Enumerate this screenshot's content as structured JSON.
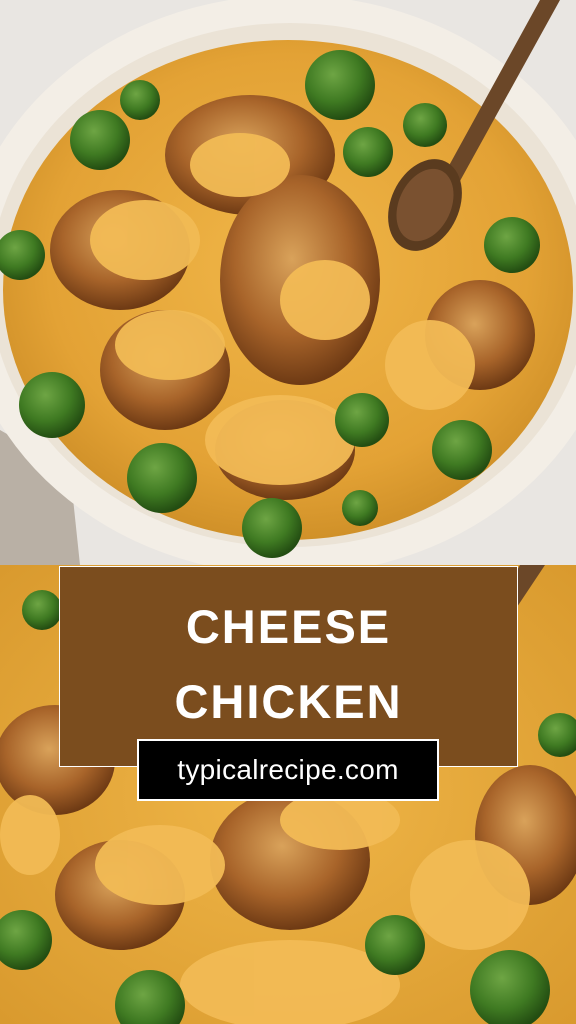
{
  "title": {
    "line1": "CHEESE",
    "line2": "CHICKEN"
  },
  "website": "typicalrecipe.com",
  "colors": {
    "panel": "#7b4d1e",
    "url_box": "#000000",
    "text": "#ffffff",
    "sauce": "#e6a93c",
    "broccoli": "#3f7a22",
    "pan": "#f1ece4"
  },
  "photo": {
    "top_alt": "skillet of golden chicken in cheese sauce with broccoli and a wooden spoon",
    "bottom_alt": "close-up of chicken pieces in cheese sauce with broccoli"
  }
}
